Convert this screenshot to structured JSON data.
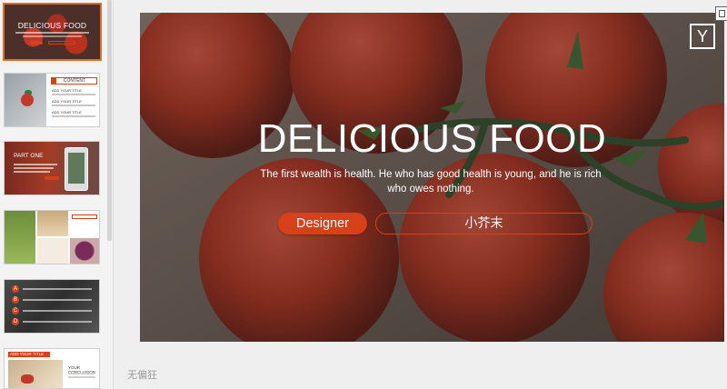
{
  "sidebar": {
    "slides": [
      {
        "title": "DELICIOUS FOOD"
      },
      {
        "header": "CONTENT",
        "items": [
          "ADD YOUR TITLE",
          "ADD YOUR TITLE",
          "ADD YOUR TITLE"
        ]
      },
      {
        "title": "PART ONE"
      },
      {
        "header": "ADD YOUR TITLE"
      },
      {
        "bullets": [
          "A",
          "B",
          "C",
          "D"
        ]
      },
      {
        "header": "ADD YOUR TITLE",
        "caption": "YOUR CONCLUSION"
      }
    ]
  },
  "slide": {
    "title": "DELICIOUS FOOD",
    "subtitle": "The first wealth is health. He who has good health is young, and he is rich who owes nothing.",
    "designer_label": "Designer",
    "name_value": "小芥末",
    "badge": "Y"
  },
  "watermark": "无偏狂",
  "colors": {
    "accent": "#d8401a",
    "active_border": "#e06b2a"
  }
}
